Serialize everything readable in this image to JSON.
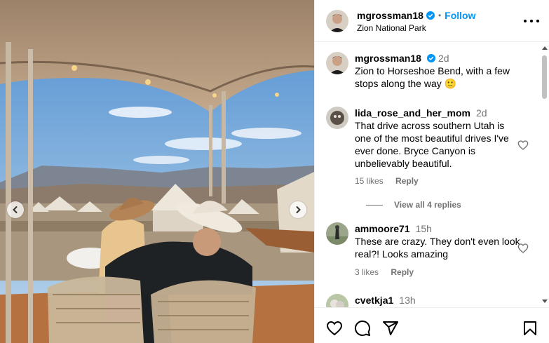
{
  "post": {
    "username": "mgrossman18",
    "follow_label": "Follow",
    "location": "Zion National Park",
    "separator": "•"
  },
  "comments": [
    {
      "username": "mgrossman18",
      "time": "2d",
      "text": "Zion to Horseshoe Bend, with a few stops along the way 🙂"
    },
    {
      "username": "lida_rose_and_her_mom",
      "time": "2d",
      "text": "That drive across southern Utah is one of the most beautiful drives I've ever done. Bryce Canyon is unbelievably beautiful.",
      "likes": "15 likes",
      "reply_label": "Reply",
      "view_replies": "View all 4 replies"
    },
    {
      "username": "ammoore71",
      "time": "15h",
      "text": "These are crazy. They don't even look real?! Looks amazing",
      "likes": "3 likes",
      "reply_label": "Reply"
    },
    {
      "username": "cvetkja1",
      "time": "13h",
      "text": ""
    }
  ],
  "icons": {
    "like": "heart-icon",
    "comment": "comment-icon",
    "share": "share-icon",
    "save": "bookmark-icon",
    "more": "more-options-icon",
    "verified": "verified-badge-icon",
    "prev": "chevron-left-icon",
    "next": "chevron-right-icon"
  },
  "colors": {
    "accent": "#0095f6",
    "secondary_text": "#737373",
    "divider": "#efefef"
  }
}
